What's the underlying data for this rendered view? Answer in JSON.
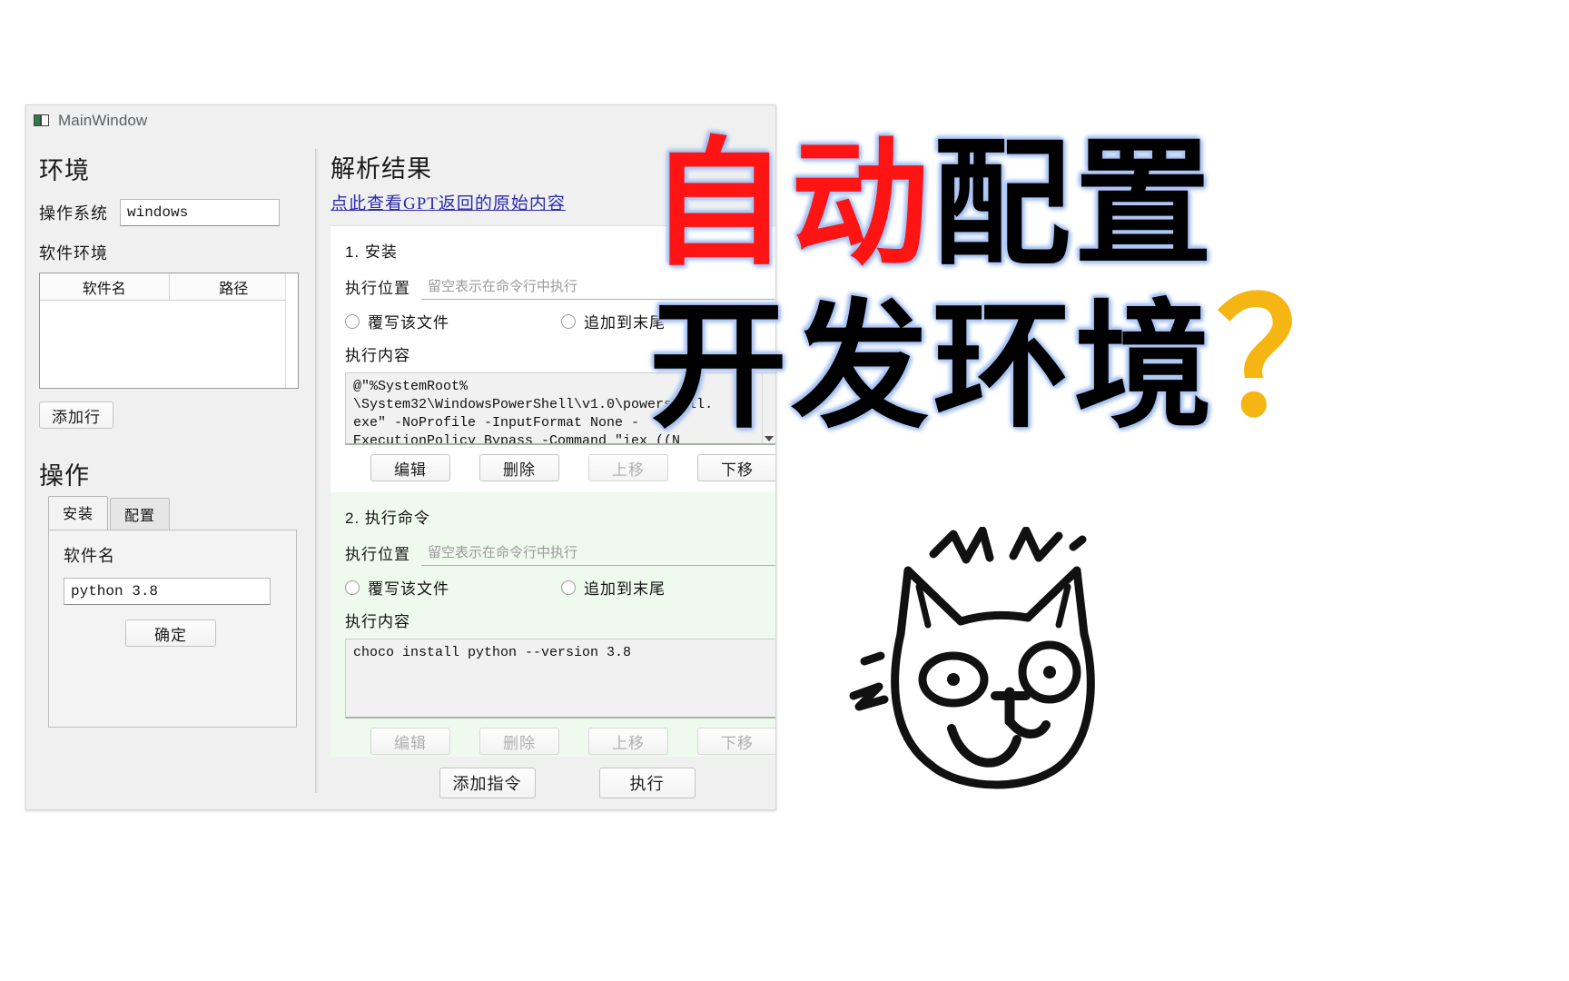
{
  "window": {
    "title": "MainWindow",
    "icon": "app-window-icon"
  },
  "left_pane": {
    "env_group_title": "环境",
    "os_label": "操作系统",
    "os_value": "windows",
    "software_env_label": "软件环境",
    "table": {
      "columns": [
        "软件名",
        "路径"
      ],
      "rows": []
    },
    "add_row_button": "添加行",
    "operation_group_title": "操作",
    "tabs": [
      {
        "label": "安装",
        "active": true
      },
      {
        "label": "配置",
        "active": false
      }
    ],
    "tab_panel": {
      "software_name_label": "软件名",
      "software_name_value": "python 3.8",
      "confirm_button": "确定"
    }
  },
  "right_pane": {
    "result_title": "解析结果",
    "gpt_link": "点此查看GPT返回的原始内容",
    "cards": [
      {
        "heading": "1. 安装",
        "location_label": "执行位置",
        "location_placeholder": "留空表示在命令行中执行",
        "radio_overwrite": "覆写该文件",
        "radio_append": "追加到末尾",
        "content_label": "执行内容",
        "content": "@\"%SystemRoot%\n\\System32\\WindowsPowerShell\\v1.0\\powershell.\nexe\" -NoProfile -InputFormat None -\nExecutionPolicy Bypass -Command \"iex ((N",
        "buttons": [
          "编辑",
          "删除",
          "上移",
          "下移"
        ],
        "disabled_buttons": [
          "上移"
        ],
        "theme": "white"
      },
      {
        "heading": "2. 执行命令",
        "location_label": "执行位置",
        "location_placeholder": "留空表示在命令行中执行",
        "radio_overwrite": "覆写该文件",
        "radio_append": "追加到末尾",
        "content_label": "执行内容",
        "content": "choco install python --version 3.8",
        "buttons": [
          "编辑",
          "删除",
          "上移",
          "下移"
        ],
        "disabled_buttons": [
          "下移"
        ],
        "theme": "green"
      }
    ],
    "bottom_buttons": {
      "add_command": "添加指令",
      "execute": "执行"
    }
  },
  "overlay": {
    "line1_red": "自动",
    "line1_black": "配置",
    "line2_black": "开发环境",
    "question_mark": "？",
    "cat_label": "cat-doodle",
    "colors": {
      "red": "#ff1414",
      "black": "#000000",
      "yellow": "#f5b512",
      "glow": "#aac4f5"
    }
  }
}
